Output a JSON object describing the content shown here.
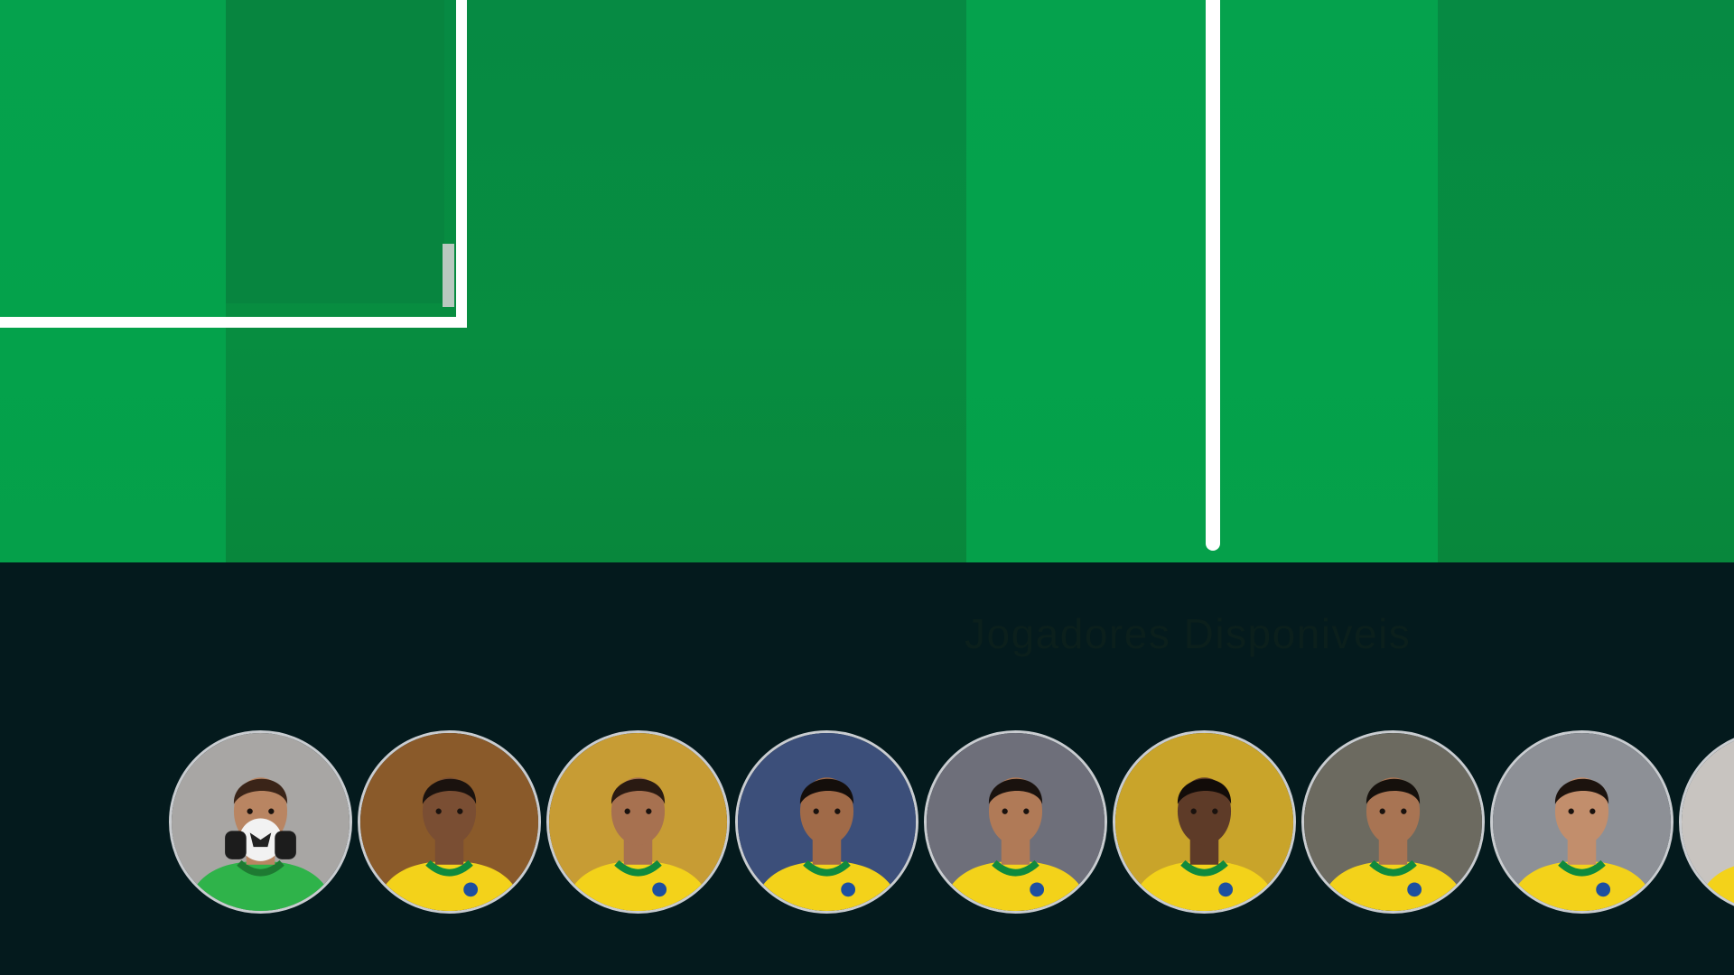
{
  "panel": {
    "title": "Jogadores Disponiveis"
  },
  "players": [
    {
      "id": "alisson",
      "bg": "#a8a6a4",
      "skin": "#b98562",
      "hair": "#3a2418",
      "shirt": "#2fb34a",
      "collar": "#1e7a32",
      "keeper": true
    },
    {
      "id": "danilo",
      "bg": "#8a5a2a",
      "skin": "#7a4e33",
      "hair": "#1a120e",
      "shirt": "#f3d21a",
      "collar": "#0f8a3d",
      "keeper": false
    },
    {
      "id": "thiago-silva",
      "bg": "#c79c34",
      "skin": "#a77150",
      "hair": "#2a1a12",
      "shirt": "#f3d21a",
      "collar": "#0f8a3d",
      "keeper": false
    },
    {
      "id": "marquinhos",
      "bg": "#3c4f7a",
      "skin": "#a06a48",
      "hair": "#140e0b",
      "shirt": "#f3d21a",
      "collar": "#0f8a3d",
      "keeper": false
    },
    {
      "id": "casemiro",
      "bg": "#6e6f7a",
      "skin": "#b07a57",
      "hair": "#1a120e",
      "shirt": "#f3d21a",
      "collar": "#0f8a3d",
      "keeper": false
    },
    {
      "id": "alex-sandro",
      "bg": "#c9a42a",
      "skin": "#5e3b28",
      "hair": "#120c09",
      "shirt": "#f3d21a",
      "collar": "#0f8a3d",
      "keeper": false
    },
    {
      "id": "raphinha",
      "bg": "#6c6a60",
      "skin": "#a87453",
      "hair": "#15100c",
      "shirt": "#f3d21a",
      "collar": "#0f8a3d",
      "keeper": false
    },
    {
      "id": "lucas-paqueta",
      "bg": "#8d9096",
      "skin": "#c28e6c",
      "hair": "#1c130e",
      "shirt": "#f3d21a",
      "collar": "#0f8a3d",
      "keeper": false
    },
    {
      "id": "neymar",
      "bg": "#c8c4c0",
      "skin": "#b58463",
      "hair": "#1a130f",
      "shirt": "#f3d21a",
      "collar": "#0f8a3d",
      "keeper": false
    }
  ]
}
